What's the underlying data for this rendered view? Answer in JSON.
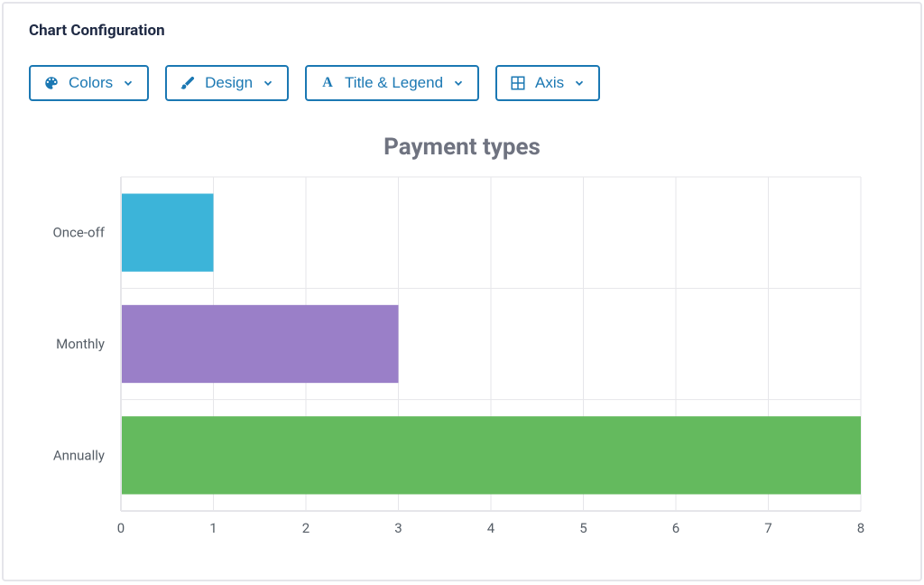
{
  "panel": {
    "title": "Chart Configuration"
  },
  "toolbar": {
    "colors_label": "Colors",
    "design_label": "Design",
    "title_legend_label": "Title & Legend",
    "axis_label": "Axis"
  },
  "chart_data": {
    "type": "bar",
    "orientation": "horizontal",
    "title": "Payment types",
    "categories": [
      "Once-off",
      "Monthly",
      "Annually"
    ],
    "values": [
      1,
      3,
      8
    ],
    "colors": [
      "#3cb4d9",
      "#9a7fc8",
      "#64ba5e"
    ],
    "xlim": [
      0,
      8
    ],
    "xticks": [
      0,
      1,
      2,
      3,
      4,
      5,
      6,
      7,
      8
    ],
    "xtick_labels": [
      "0",
      "1",
      "2",
      "3",
      "4",
      "5",
      "6",
      "7",
      "8"
    ],
    "xlabel": "",
    "ylabel": ""
  }
}
